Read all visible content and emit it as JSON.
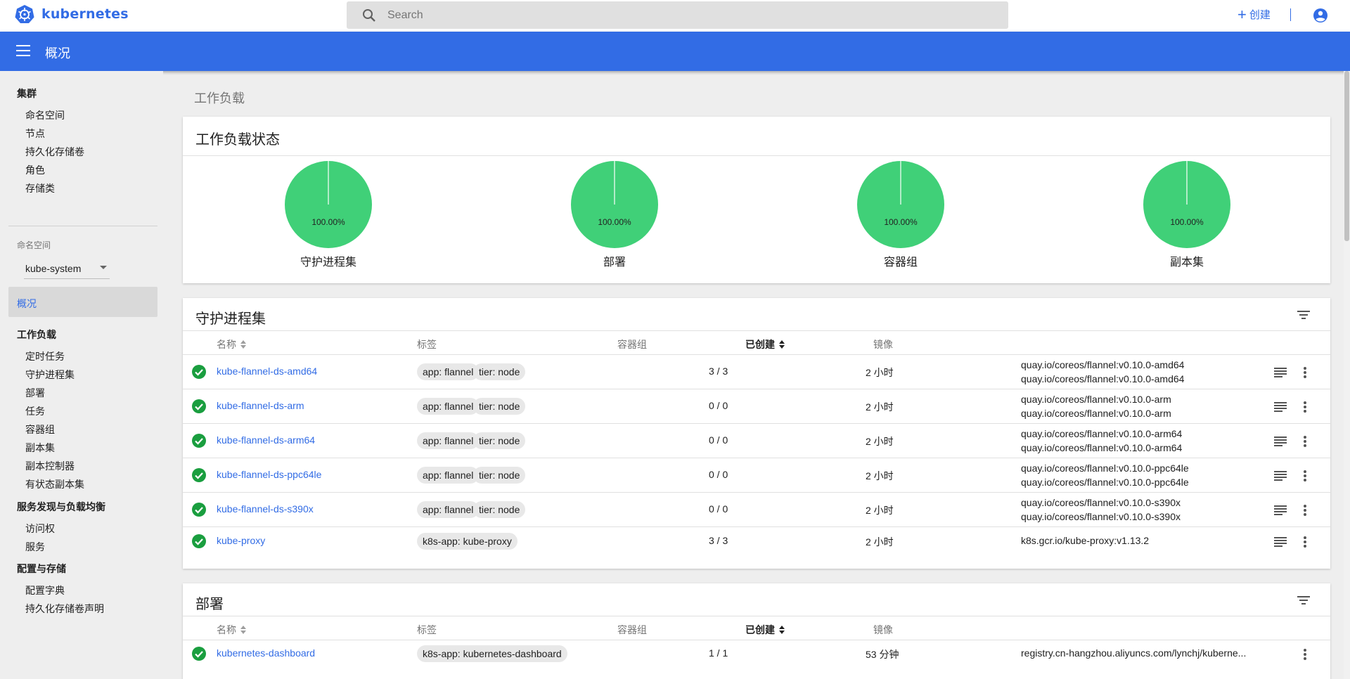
{
  "topbar": {
    "brand": "kubernetes",
    "search_placeholder": "Search",
    "create_label": "创建"
  },
  "header": {
    "title": "概况"
  },
  "sidebar": {
    "cluster_title": "集群",
    "cluster_items": [
      "命名空间",
      "节点",
      "持久化存储卷",
      "角色",
      "存储类"
    ],
    "namespace_label": "命名空间",
    "namespace_value": "kube-system",
    "overview": "概况",
    "workloads_title": "工作负载",
    "workload_items": [
      "定时任务",
      "守护进程集",
      "部署",
      "任务",
      "容器组",
      "副本集",
      "副本控制器",
      "有状态副本集"
    ],
    "discovery_title": "服务发现与负载均衡",
    "discovery_items": [
      "访问权",
      "服务"
    ],
    "config_title": "配置与存储",
    "config_items": [
      "配置字典",
      "持久化存储卷声明"
    ]
  },
  "main": {
    "breadcrumb": "工作负载",
    "status_card": {
      "title": "工作负载状态",
      "pies": [
        {
          "label": "守护进程集",
          "percent_text": "100.00%",
          "running": 1.0
        },
        {
          "label": "部署",
          "percent_text": "100.00%",
          "running": 1.0
        },
        {
          "label": "容器组",
          "percent_text": "100.00%",
          "running": 1.0
        },
        {
          "label": "副本集",
          "percent_text": "100.00%",
          "running": 1.0
        }
      ]
    },
    "columns": {
      "name": "名称",
      "labels": "标签",
      "pods": "容器组",
      "created": "已创建",
      "images": "镜像"
    },
    "daemonsets": {
      "title": "守护进程集",
      "rows": [
        {
          "name": "kube-flannel-ds-amd64",
          "labels": [
            "app: flannel",
            "tier: node"
          ],
          "pods": "3 / 3",
          "age": "2 小时",
          "images": [
            "quay.io/coreos/flannel:v0.10.0-amd64",
            "quay.io/coreos/flannel:v0.10.0-amd64"
          ]
        },
        {
          "name": "kube-flannel-ds-arm",
          "labels": [
            "app: flannel",
            "tier: node"
          ],
          "pods": "0 / 0",
          "age": "2 小时",
          "images": [
            "quay.io/coreos/flannel:v0.10.0-arm",
            "quay.io/coreos/flannel:v0.10.0-arm"
          ]
        },
        {
          "name": "kube-flannel-ds-arm64",
          "labels": [
            "app: flannel",
            "tier: node"
          ],
          "pods": "0 / 0",
          "age": "2 小时",
          "images": [
            "quay.io/coreos/flannel:v0.10.0-arm64",
            "quay.io/coreos/flannel:v0.10.0-arm64"
          ]
        },
        {
          "name": "kube-flannel-ds-ppc64le",
          "labels": [
            "app: flannel",
            "tier: node"
          ],
          "pods": "0 / 0",
          "age": "2 小时",
          "images": [
            "quay.io/coreos/flannel:v0.10.0-ppc64le",
            "quay.io/coreos/flannel:v0.10.0-ppc64le"
          ]
        },
        {
          "name": "kube-flannel-ds-s390x",
          "labels": [
            "app: flannel",
            "tier: node"
          ],
          "pods": "0 / 0",
          "age": "2 小时",
          "images": [
            "quay.io/coreos/flannel:v0.10.0-s390x",
            "quay.io/coreos/flannel:v0.10.0-s390x"
          ]
        },
        {
          "name": "kube-proxy",
          "labels": [
            "k8s-app: kube-proxy"
          ],
          "pods": "3 / 3",
          "age": "2 小时",
          "images": [
            "k8s.gcr.io/kube-proxy:v1.13.2"
          ]
        }
      ]
    },
    "deployments": {
      "title": "部署",
      "rows": [
        {
          "name": "kubernetes-dashboard",
          "labels": [
            "k8s-app: kubernetes-dashboard"
          ],
          "pods": "1 / 1",
          "age": "53 分钟",
          "images": [
            "registry.cn-hangzhou.aliyuncs.com/lynchj/kuberne..."
          ]
        }
      ]
    }
  },
  "colors": {
    "accent": "#326ce5",
    "pie": "#40d078",
    "ok": "#1a9e3f"
  },
  "icons": {
    "logo": "kubernetes-logo-icon",
    "search": "search-icon",
    "account": "account-circle-icon",
    "filter": "filter-icon",
    "status": "check-circle-icon",
    "logs": "logs-icon",
    "more": "more-vert-icon"
  }
}
